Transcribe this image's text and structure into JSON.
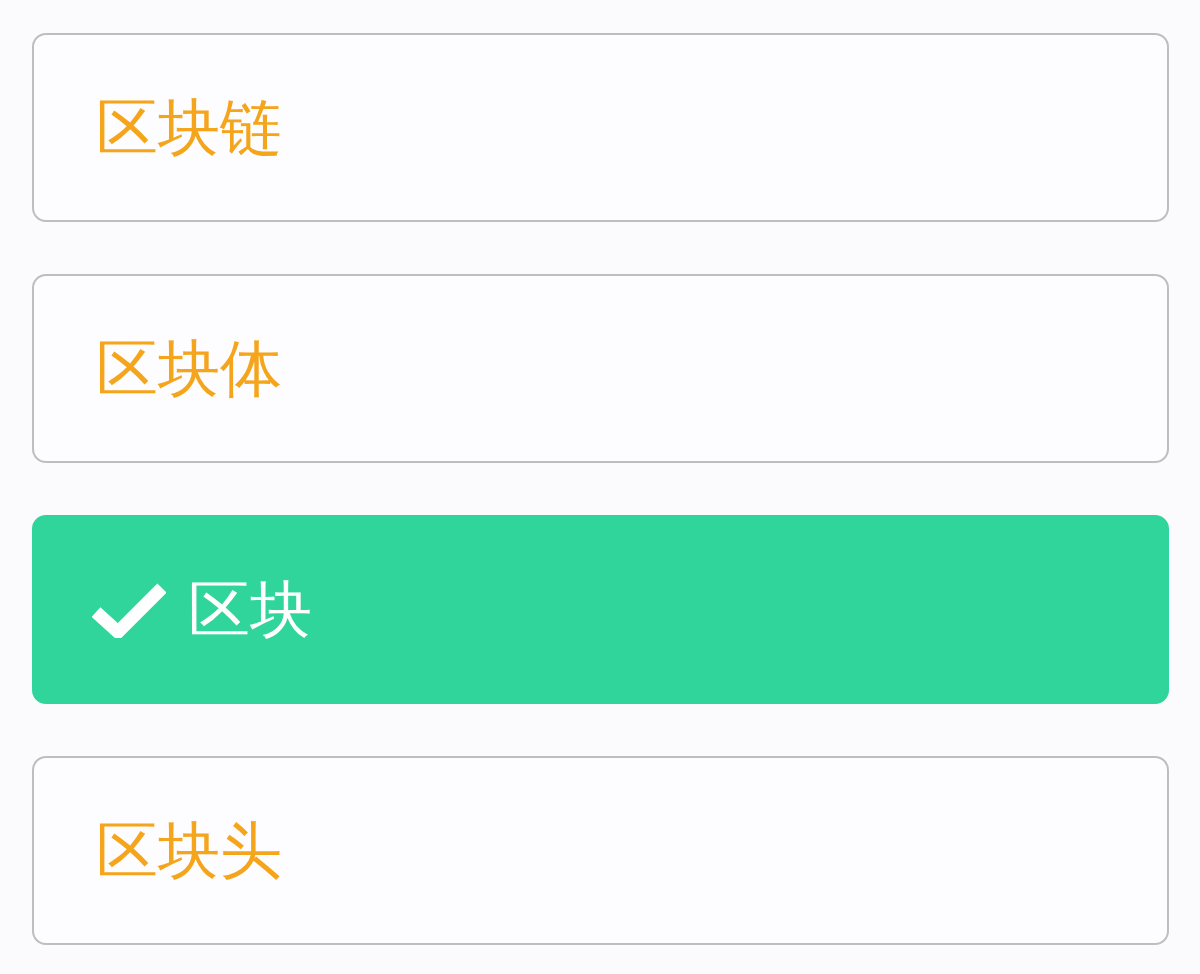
{
  "options": [
    {
      "label": "区块链",
      "selected": false
    },
    {
      "label": "区块体",
      "selected": false
    },
    {
      "label": "区块",
      "selected": true
    },
    {
      "label": "区块头",
      "selected": false
    }
  ]
}
